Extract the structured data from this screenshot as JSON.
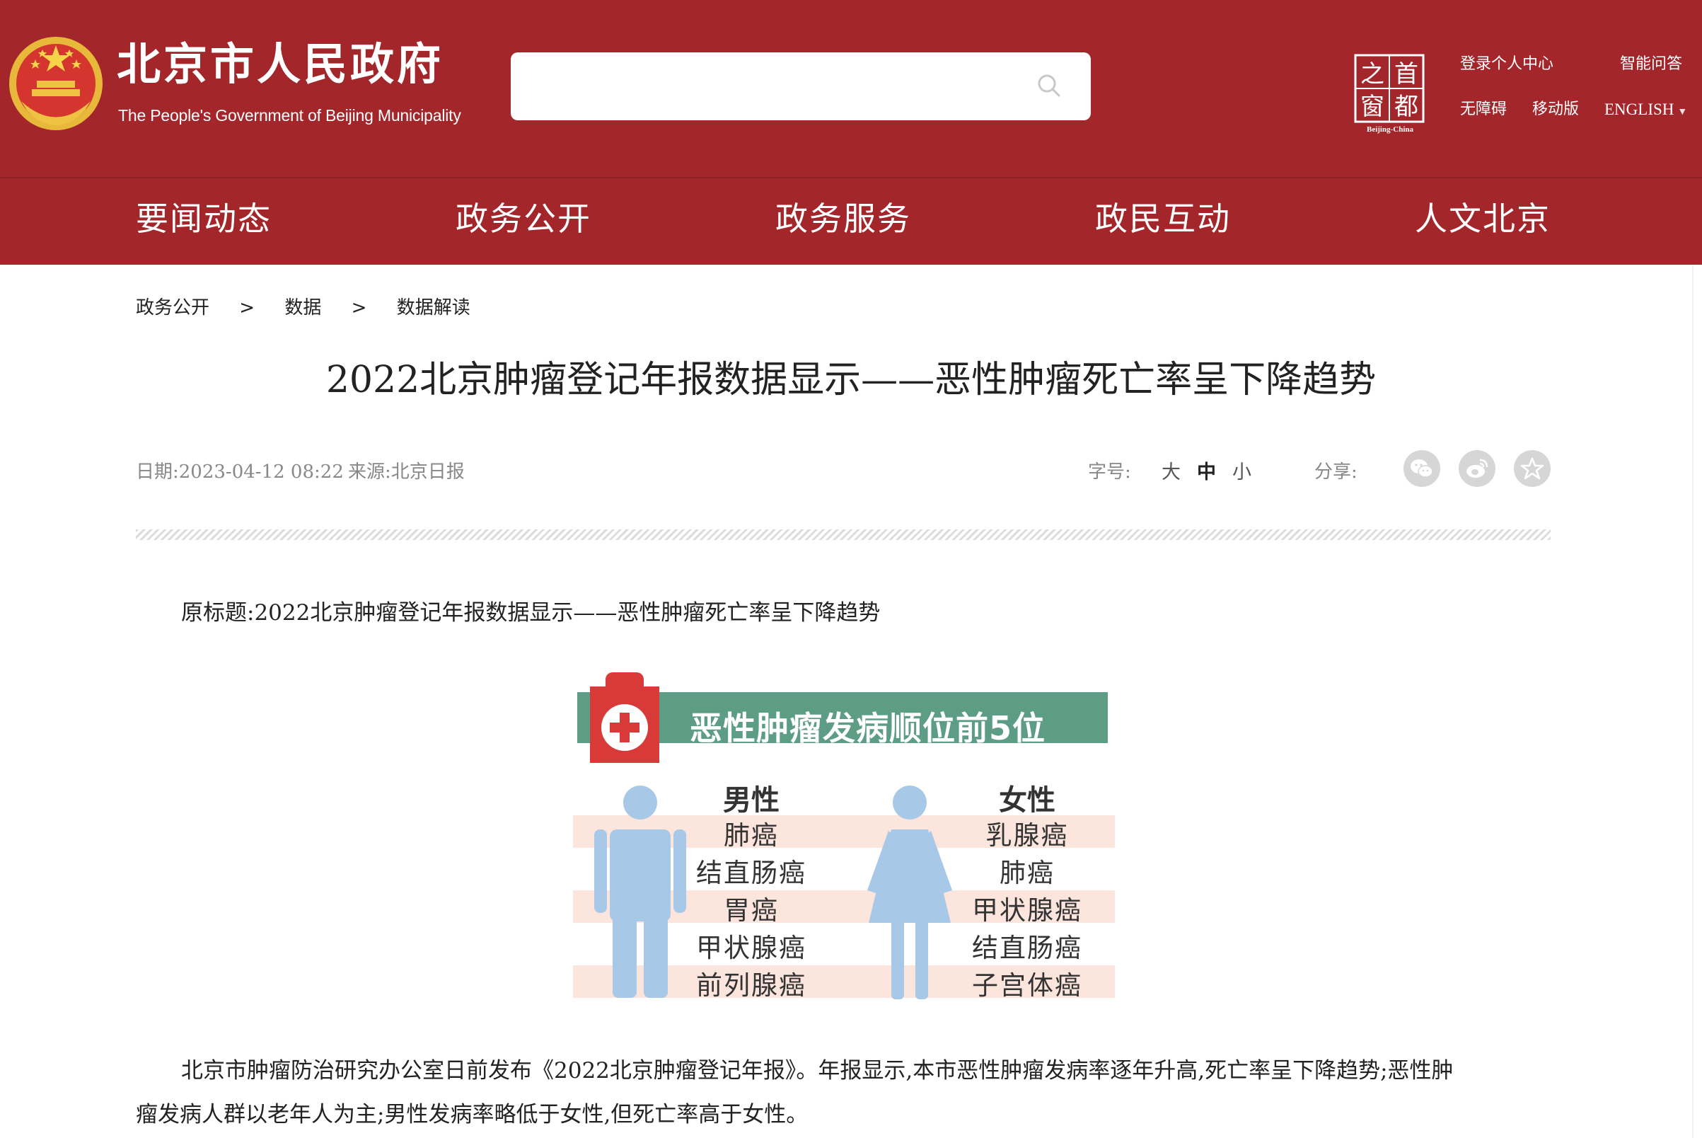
{
  "header": {
    "site_title": "北京市人民政府",
    "site_subtitle": "The People's Government of Beijing Municipality",
    "search_placeholder": "",
    "capital_logo": {
      "chars": [
        "之",
        "首",
        "窗",
        "都"
      ],
      "caption": "Beijing-China"
    },
    "links": {
      "login": "登录个人中心",
      "ai_qa": "智能问答",
      "accessibility": "无障碍",
      "mobile": "移动版",
      "english": "ENGLISH"
    }
  },
  "nav": [
    "要闻动态",
    "政务公开",
    "政务服务",
    "政民互动",
    "人文北京"
  ],
  "breadcrumb": [
    "政务公开",
    "数据",
    "数据解读"
  ],
  "breadcrumb_sep": ">",
  "article": {
    "title": "2022北京肿瘤登记年报数据显示——恶性肿瘤死亡率呈下降趋势",
    "date_label": "日期:",
    "date": "2023-04-12 08:22",
    "source_label": "来源:",
    "source": "北京日报",
    "font_size_label": "字号:",
    "font_sizes": [
      "大",
      "中",
      "小"
    ],
    "share_label": "分享:",
    "share_icons": [
      "wechat-icon",
      "weibo-icon",
      "favorite-icon"
    ],
    "original_title": "原标题:2022北京肿瘤登记年报数据显示——恶性肿瘤死亡率呈下降趋势",
    "paragraph1_line1": "北京市肿瘤防治研究办公室日前发布《2022北京肿瘤登记年报》。年报显示,本市恶性肿瘤发病率逐年升高,死亡率呈下降趋势;恶性肿",
    "paragraph1_line2": "瘤发病人群以老年人为主;男性发病率略低于女性,但死亡率高于女性。"
  },
  "infographic": {
    "title": "恶性肿瘤发病顺位前5位",
    "male_label": "男性",
    "female_label": "女性",
    "male": [
      "肺癌",
      "结直肠癌",
      "胃癌",
      "甲状腺癌",
      "前列腺癌"
    ],
    "female": [
      "乳腺癌",
      "肺癌",
      "甲状腺癌",
      "结直肠癌",
      "子宫体癌"
    ]
  },
  "colors": {
    "header_red": "#a3262b",
    "banner_green": "#5d9d85",
    "figure_blue": "#a8c8e8",
    "row_shade": "#fbe5dc",
    "icon_red": "#d83a3a"
  }
}
